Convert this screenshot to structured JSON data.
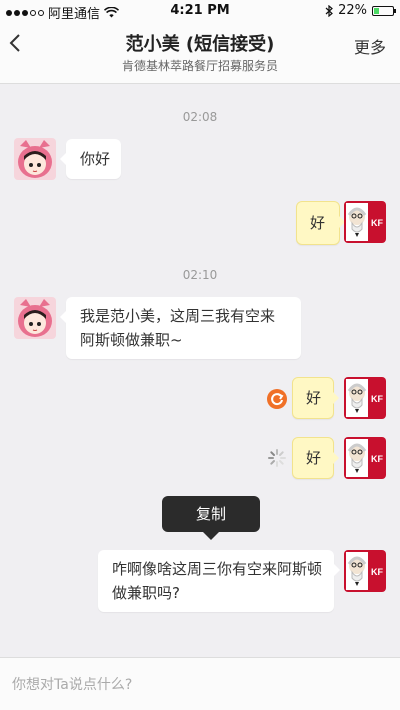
{
  "status_bar": {
    "carrier": "阿里通信",
    "time": "4:21 PM",
    "battery": "22%",
    "battery_level": 0.22
  },
  "header": {
    "back_icon": "chevron-left-icon",
    "title": "范小美 (短信接受)",
    "subtitle": "肯德基林萃路餐厅招募服务员",
    "more_label": "更多"
  },
  "chat": {
    "timestamps": [
      "02:08",
      "02:10"
    ],
    "messages": [
      {
        "side": "left",
        "text": "你好"
      },
      {
        "side": "right",
        "text": "好"
      },
      {
        "side": "left",
        "text": "我是范小美，这周三我有空来阿斯顿做兼职~"
      },
      {
        "side": "right",
        "text": "好",
        "status": "failed-retry-icon"
      },
      {
        "side": "right",
        "text": "好",
        "status": "sending-spinner-icon"
      },
      {
        "side": "right",
        "text": "咋啊像啥这周三你有空来阿斯顿做兼职吗?"
      }
    ],
    "context_menu": {
      "copy_label": "复制"
    }
  },
  "composer": {
    "placeholder": "你想对Ta说点什么?"
  },
  "colors": {
    "background": "#f0eff2",
    "avatar_pink": "#e8708f",
    "kfc_red": "#c8102e",
    "retry_orange": "#f07027",
    "highlight_bubble": "#fff8c4"
  }
}
